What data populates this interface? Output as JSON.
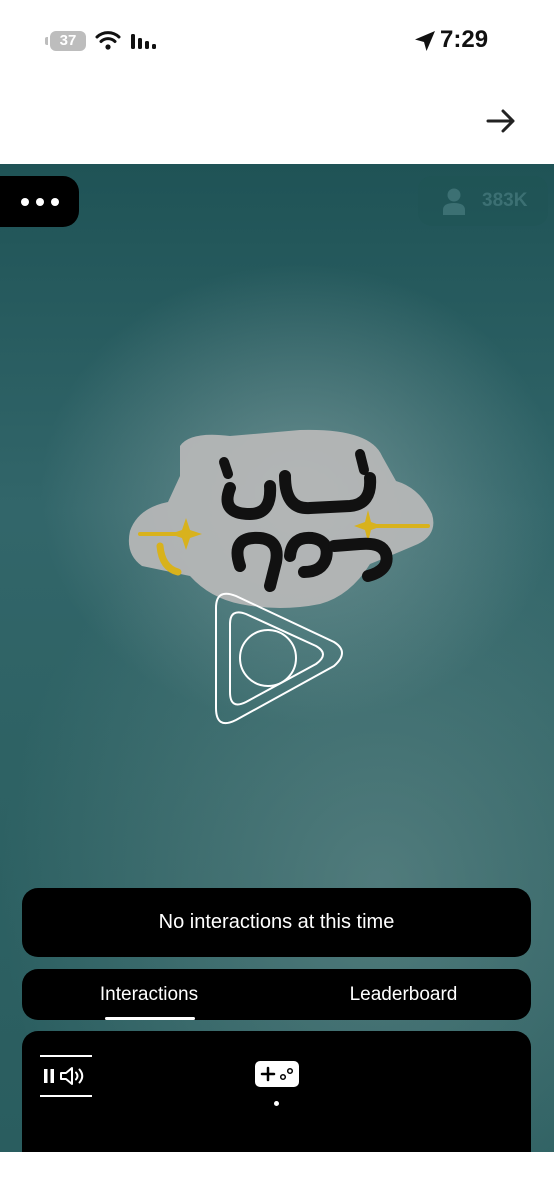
{
  "status_bar": {
    "battery_level": "37",
    "time": "7:29"
  },
  "stream": {
    "viewer_count": "383K"
  },
  "notice": {
    "text": "No interactions at this time"
  },
  "tabs": [
    {
      "label": "Interactions",
      "active": true
    },
    {
      "label": "Leaderboard",
      "active": false
    }
  ],
  "colors": {
    "stage_dark": "#1f5356",
    "stage_light": "#5a8486",
    "panel": "#000000",
    "logo_gold": "#d8b21c"
  }
}
